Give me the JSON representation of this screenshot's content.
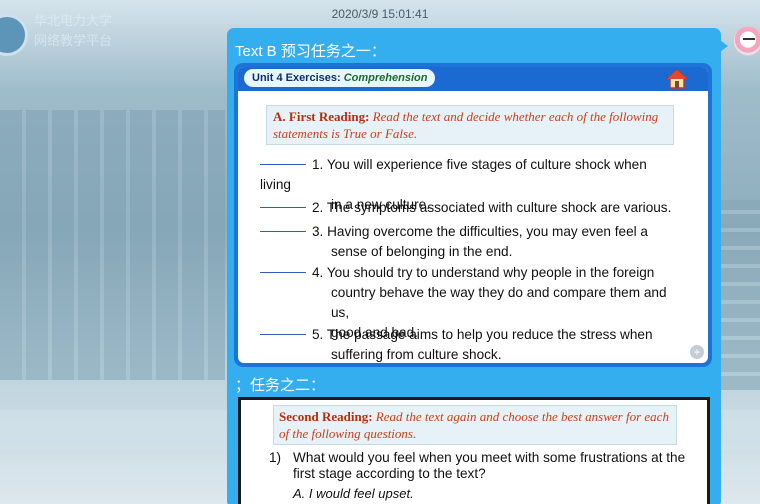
{
  "background": {
    "school_name_line1": "华北电力大学",
    "school_name_line2": "网络教学平台"
  },
  "chat": {
    "timestamp": "2020/3/9 15:01:41",
    "message_line1": "Text B 预习任务之一：",
    "message_line2": "；任务之二："
  },
  "slide1": {
    "unit_prefix": "Unit 4 Exercises: ",
    "unit_emphasis": "Comprehension",
    "task_lead": "A.  First Reading:",
    "task_text": " Read the text and decide whether each of the following statements is True or False.",
    "statements": [
      {
        "line1": "1. You will experience five stages of culture shock when living",
        "line2": "in a new culture."
      },
      {
        "line1": "2. The symptoms associated with culture shock are various.",
        "line2": ""
      },
      {
        "line1": "3. Having overcome the difficulties, you may even feel a",
        "line2": "sense of belonging in the end."
      },
      {
        "line1": "4. You should try to understand why people in the foreign",
        "line2": "country behave the way they do and compare them and us,",
        "line3": "good and bad."
      },
      {
        "line1": "5. The passage aims to help you reduce the stress when",
        "line2": "suffering from culture shock."
      }
    ]
  },
  "slide2": {
    "task_lead": "Second Reading:",
    "task_text": " Read the text again and choose the best answer for each of the following questions.",
    "q_num": "1)",
    "q_line1": "What would you feel when you meet with some frustrations at the",
    "q_line2": "first stage according to the text?",
    "option_a": "A. I would feel upset."
  },
  "colors": {
    "bubble": "#35aef0",
    "slide_frame": "#1d73d8",
    "task_red": "#c8401b"
  }
}
